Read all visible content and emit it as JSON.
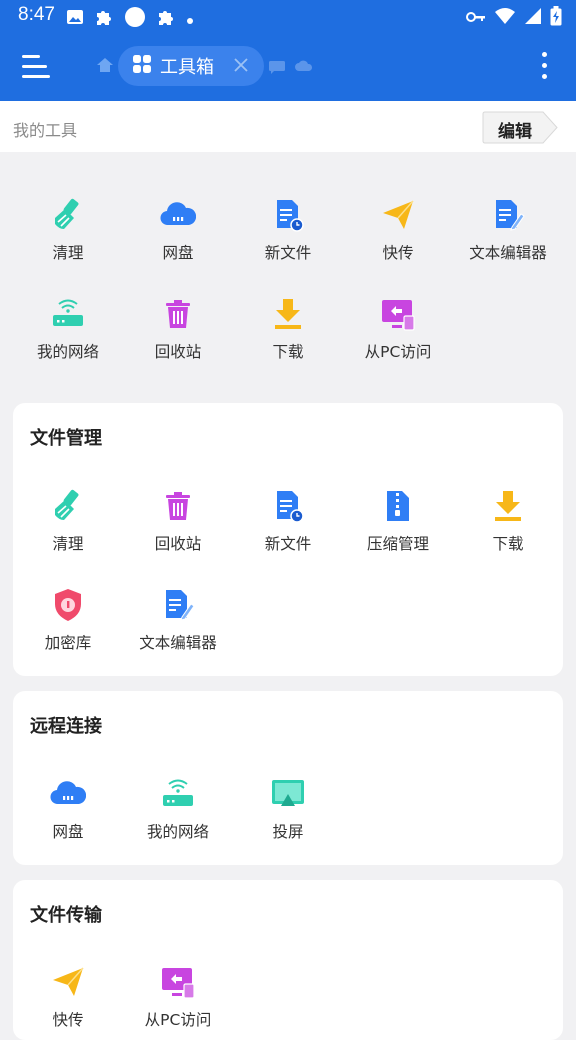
{
  "status_bar": {
    "time": "8:47"
  },
  "app_bar": {
    "active_tab_label": "工具箱"
  },
  "my_tools": {
    "title": "我的工具",
    "edit_label": "编辑",
    "items": [
      {
        "label": "清理",
        "icon": "broom-icon"
      },
      {
        "label": "网盘",
        "icon": "cloud-drive-icon"
      },
      {
        "label": "新文件",
        "icon": "new-file-icon"
      },
      {
        "label": "快传",
        "icon": "paper-plane-icon"
      },
      {
        "label": "文本编辑器",
        "icon": "text-editor-icon"
      },
      {
        "label": "我的网络",
        "icon": "router-icon"
      },
      {
        "label": "回收站",
        "icon": "recycle-bin-icon"
      },
      {
        "label": "下载",
        "icon": "download-icon"
      },
      {
        "label": "从PC访问",
        "icon": "pc-access-icon"
      }
    ]
  },
  "sections": [
    {
      "title": "文件管理",
      "items": [
        {
          "label": "清理",
          "icon": "broom-icon"
        },
        {
          "label": "回收站",
          "icon": "recycle-bin-icon"
        },
        {
          "label": "新文件",
          "icon": "new-file-icon"
        },
        {
          "label": "压缩管理",
          "icon": "zip-icon"
        },
        {
          "label": "下载",
          "icon": "download-icon"
        },
        {
          "label": "加密库",
          "icon": "vault-shield-icon"
        },
        {
          "label": "文本编辑器",
          "icon": "text-editor-icon"
        }
      ]
    },
    {
      "title": "远程连接",
      "items": [
        {
          "label": "网盘",
          "icon": "cloud-drive-icon"
        },
        {
          "label": "我的网络",
          "icon": "router-icon"
        },
        {
          "label": "投屏",
          "icon": "cast-screen-icon"
        }
      ]
    },
    {
      "title": "文件传输",
      "items": [
        {
          "label": "快传",
          "icon": "paper-plane-icon"
        },
        {
          "label": "从PC访问",
          "icon": "pc-access-icon"
        }
      ]
    }
  ],
  "colors": {
    "brand_blue": "#1f6ee0",
    "teal": "#2fcfb0",
    "blue": "#2f7ef5",
    "yellow": "#f7b718",
    "magenta": "#c845e0",
    "pink": "#f04a6b"
  }
}
